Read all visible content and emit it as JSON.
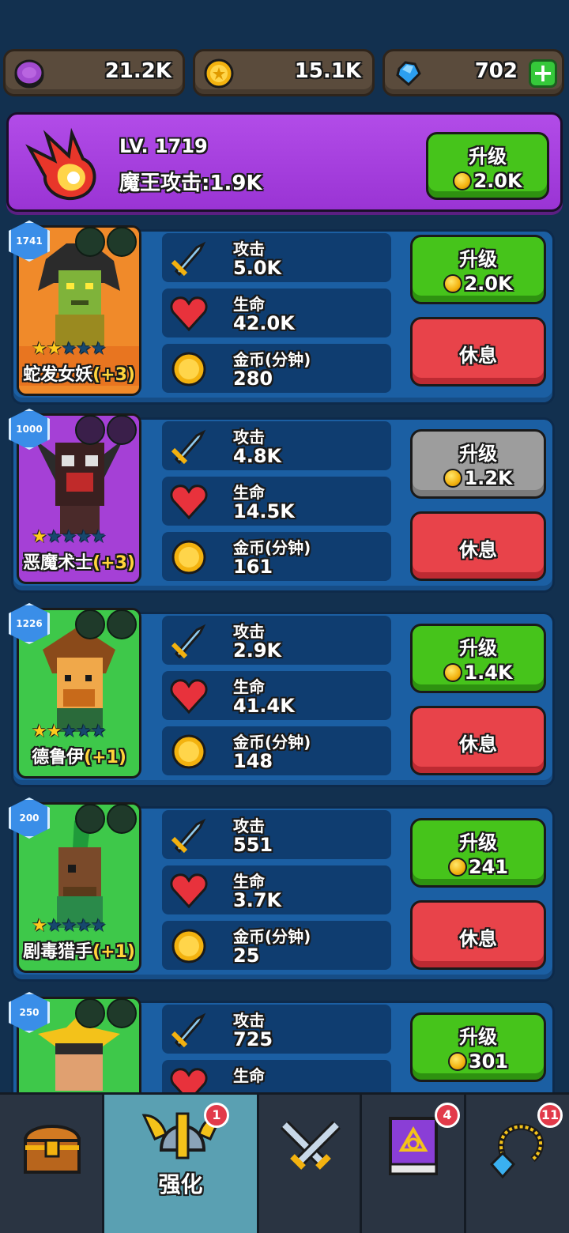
{
  "currencies": {
    "purple_coins": "21.2K",
    "gold_coins": "15.1K",
    "gems": "702"
  },
  "demon_king": {
    "level": "LV. 1719",
    "attack": "魔王攻击:1.9K",
    "upgrade_label": "升级",
    "upgrade_cost": "2.0K"
  },
  "stat_labels": {
    "attack": "攻击",
    "hp": "生命",
    "gold": "金币(分钟)"
  },
  "buttons": {
    "upgrade": "升级",
    "rest": "休息"
  },
  "heroes": [
    {
      "level": "1741",
      "name": "蛇发女妖",
      "bonus": "(+3)",
      "stars": 2,
      "attack": "5.0K",
      "hp": "42.0K",
      "gold": "280",
      "upgrade_cost": "2.0K",
      "can_upgrade": true
    },
    {
      "level": "1000",
      "name": "恶魔术士",
      "bonus": "(+3)",
      "stars": 1,
      "attack": "4.8K",
      "hp": "14.5K",
      "gold": "161",
      "upgrade_cost": "1.2K",
      "can_upgrade": false
    },
    {
      "level": "1226",
      "name": "德鲁伊",
      "bonus": "(+1)",
      "stars": 2,
      "attack": "2.9K",
      "hp": "41.4K",
      "gold": "148",
      "upgrade_cost": "1.4K",
      "can_upgrade": true
    },
    {
      "level": "200",
      "name": "剧毒猎手",
      "bonus": "(+1)",
      "stars": 1,
      "attack": "551",
      "hp": "3.7K",
      "gold": "25",
      "upgrade_cost": "241",
      "can_upgrade": true
    },
    {
      "level": "250",
      "name": "",
      "bonus": "",
      "stars": 0,
      "attack": "725",
      "hp": "",
      "gold": "",
      "upgrade_cost": "301",
      "can_upgrade": true
    }
  ],
  "nav": {
    "active_label": "强化",
    "badges": {
      "upgrade": "1",
      "spellbook": "4",
      "amulet": "11"
    }
  },
  "colors": {
    "background": "#12304f",
    "card": "#1b5fa3",
    "green_button": "#46c41b",
    "red_button": "#e8434a",
    "gray_button": "#9d9d9d",
    "purple_banner": "#b24ce8"
  }
}
